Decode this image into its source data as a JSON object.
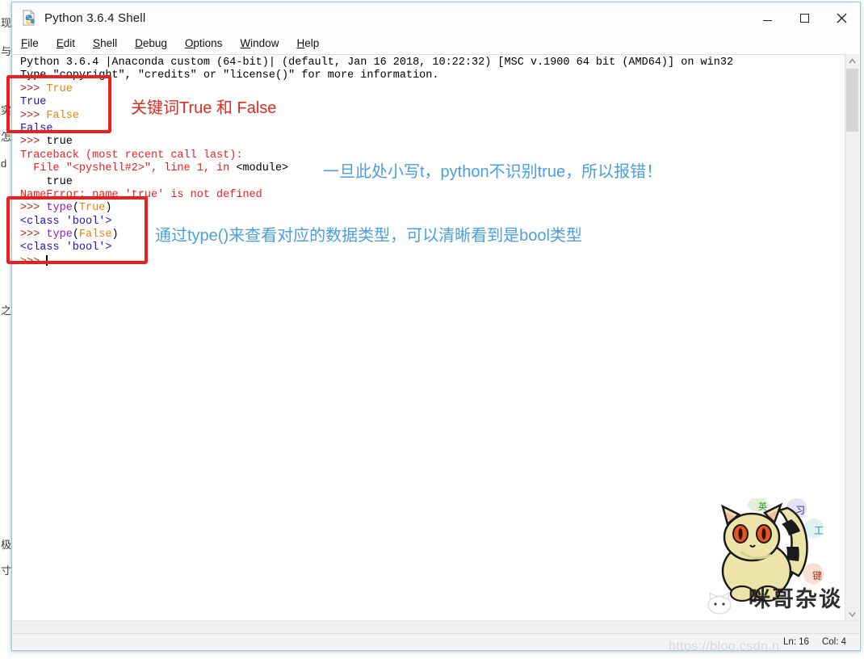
{
  "window": {
    "title": "Python 3.6.4 Shell",
    "icon": "python-file-icon",
    "controls": {
      "minimize": "minimize-icon",
      "maximize": "maximize-icon",
      "close": "close-icon"
    }
  },
  "menubar": {
    "items": [
      {
        "mnemonic": "F",
        "rest": "ile"
      },
      {
        "mnemonic": "E",
        "rest": "dit"
      },
      {
        "mnemonic": "S",
        "rest": "hell"
      },
      {
        "mnemonic": "D",
        "rest": "ebug"
      },
      {
        "mnemonic": "O",
        "rest": "ptions"
      },
      {
        "mnemonic": "W",
        "rest": "indow"
      },
      {
        "mnemonic": "H",
        "rest": "elp"
      }
    ]
  },
  "console": {
    "lines": [
      [
        {
          "t": "Python 3.6.4 |Anaconda custom (64-bit)| (default, Jan 16 2018, 10:22:32) [MSC v.1900 64 bit (AMD64)] on win32",
          "c": "black"
        }
      ],
      [
        {
          "t": "Type \"copyright\", \"credits\" or \"license()\" for more information.",
          "c": "black"
        }
      ],
      [
        {
          "t": ">>> ",
          "c": "prompt"
        },
        {
          "t": "True",
          "c": "in"
        }
      ],
      [
        {
          "t": "True",
          "c": "out"
        }
      ],
      [
        {
          "t": ">>> ",
          "c": "prompt"
        },
        {
          "t": "False",
          "c": "in"
        }
      ],
      [
        {
          "t": "False",
          "c": "out"
        }
      ],
      [
        {
          "t": ">>> ",
          "c": "prompt"
        },
        {
          "t": "true",
          "c": "black"
        }
      ],
      [
        {
          "t": "Traceback (most recent call last):",
          "c": "err"
        }
      ],
      [
        {
          "t": "  File \"<pyshell#2>\", line 1, in ",
          "c": "err"
        },
        {
          "t": "<module>",
          "c": "black"
        }
      ],
      [
        {
          "t": "    true",
          "c": "black"
        }
      ],
      [
        {
          "t": "NameError: name 'true' is not defined",
          "c": "err"
        }
      ],
      [
        {
          "t": ">>> ",
          "c": "prompt"
        },
        {
          "t": "type",
          "c": "kw"
        },
        {
          "t": "(",
          "c": "black"
        },
        {
          "t": "True",
          "c": "in"
        },
        {
          "t": ")",
          "c": "black"
        }
      ],
      [
        {
          "t": "<class 'bool'>",
          "c": "out"
        }
      ],
      [
        {
          "t": ">>> ",
          "c": "prompt"
        },
        {
          "t": "type",
          "c": "kw"
        },
        {
          "t": "(",
          "c": "black"
        },
        {
          "t": "False",
          "c": "in"
        },
        {
          "t": ")",
          "c": "black"
        }
      ],
      [
        {
          "t": "<class 'bool'>",
          "c": "out"
        }
      ],
      [
        {
          "t": ">>> ",
          "c": "prompt"
        }
      ]
    ]
  },
  "annotations": [
    {
      "id": "keyword-note",
      "text": "关键词True 和 False",
      "color": "#e02b20"
    },
    {
      "id": "lowercase-note",
      "text": "一旦此处小写t，python不识别true，所以报错！",
      "color": "#4a9fe0"
    },
    {
      "id": "type-note",
      "text": "通过type()来查看对应的数据类型，可以清晰看到是bool类型",
      "color": "#4a9fe0"
    }
  ],
  "statusbar": {
    "line": "Ln: 16",
    "col": "Col: 4"
  },
  "watermarks": {
    "brand": "咪哥杂谈",
    "csdn": "https://blog.csdn.n"
  },
  "background_fragments": {
    "left_chars": [
      "现",
      "与",
      "实",
      "怎",
      "d",
      "之",
      "极",
      "寸"
    ]
  },
  "scrollbars": {
    "vertical_up": "chevron-up-icon",
    "vertical_down": "chevron-down-icon"
  }
}
